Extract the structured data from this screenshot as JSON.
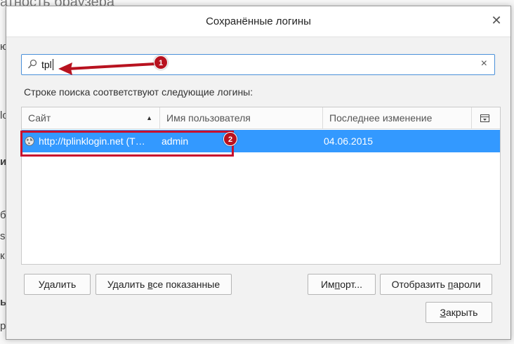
{
  "background": {
    "title_fragment": "атность браузера",
    "side_fragments": [
      "ю",
      "lo",
      "и",
      "б",
      "s",
      "к",
      "ы",
      "р"
    ]
  },
  "dialog": {
    "title": "Сохранённые логины",
    "close_glyph": "✕"
  },
  "search": {
    "value": "tpl",
    "clear_glyph": "×"
  },
  "hint_text": "Строке поиска соответствуют следующие логины:",
  "table": {
    "columns": [
      "Сайт",
      "Имя пользователя",
      "Последнее изменение"
    ],
    "sort_glyph": "▲",
    "rows": [
      {
        "site": "http://tplinklogin.net (T…",
        "username": "admin",
        "last_changed": "04.06.2015",
        "selected": true
      }
    ]
  },
  "annotations": {
    "badge_1": "1",
    "badge_2": "2",
    "color": "#c8102e"
  },
  "buttons": {
    "delete": {
      "pre": "У",
      "ul": "д",
      "post": "алить"
    },
    "delete_all": {
      "pre": "Удалить ",
      "ul": "в",
      "post": "се показанные"
    },
    "import": {
      "pre": "Им",
      "ul": "п",
      "post": "орт..."
    },
    "show_passwords": {
      "pre": "Отобразить ",
      "ul": "п",
      "post": "ароли"
    },
    "close": {
      "pre": "",
      "ul": "З",
      "post": "акрыть"
    }
  },
  "colors": {
    "selection": "#3399ff",
    "focus_border": "#4a90d9"
  },
  "icons": [
    "search-icon",
    "clear-icon",
    "close-icon",
    "globe-icon",
    "column-picker-icon",
    "sort-ascending-icon"
  ]
}
